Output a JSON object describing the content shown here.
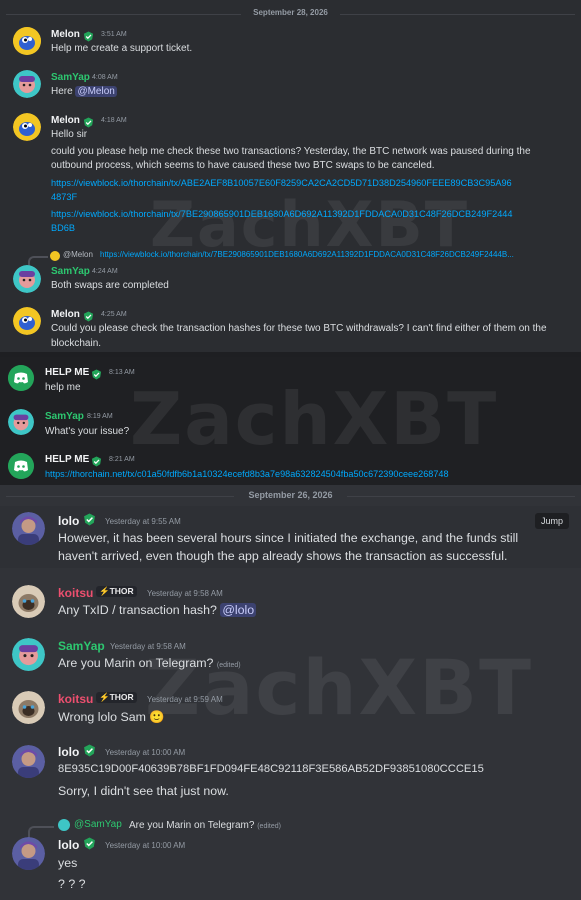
{
  "watermark": "ZachXBT",
  "colors": {
    "green_name": "#2dc770",
    "red_name": "#ed4f6f",
    "link": "#00a8fc",
    "mention_bg": "#3c4270"
  },
  "panel1": {
    "date": "September 28, 2026",
    "m1": {
      "author": "Melon",
      "time": "3:51 AM",
      "text": "Help me create a support ticket."
    },
    "m2": {
      "author": "SamYap",
      "time": "4:08 AM",
      "text_prefix": "Here ",
      "mention": "@Melon"
    },
    "m3": {
      "author": "Melon",
      "time": "4:18 AM",
      "line1": "Hello sir",
      "line2": "could you please help me check these two transactions? Yesterday, the BTC network was paused during the",
      "line3": "outbound process, which seems to have caused these two BTC swaps to be canceled.",
      "link1a": "https://viewblock.io/thorchain/tx/ABE2AEF8B10057E60F8259CA2CA2CD5D71D38D254960FEEE89CB3C95A96",
      "link1b": "4873F",
      "link2a": "https://viewblock.io/thorchain/tx/7BE290865901DEB1680A6D692A11392D1FDDACA0D31C48F26DCB249F2444",
      "link2b": "BD6B"
    },
    "m4": {
      "reply_author": "@Melon",
      "reply_text": "https://viewblock.io/thorchain/tx/7BE290865901DEB1680A6D692A11392D1FDDACA0D31C48F26DCB249F2444B...",
      "author": "SamYap",
      "time": "4:24 AM",
      "text": "Both swaps are completed"
    },
    "m5": {
      "author": "Melon",
      "time": "4:25 AM",
      "line1": "Could you please check the transaction hashes for these two BTC withdrawals? I can't find either of them on the",
      "line2": "blockchain."
    }
  },
  "panel2": {
    "m1": {
      "author": "HELP ME",
      "time": "8:13 AM",
      "text": "help me"
    },
    "m2": {
      "author": "SamYap",
      "time": "8:19 AM",
      "text": "What's your issue?"
    },
    "m3": {
      "author": "HELP ME",
      "time": "8:21 AM",
      "link": "https://thorchain.net/tx/c01a50fdfb6b1a10324ecefd8b3a7e98a632824504fba50c672390ceee268748"
    }
  },
  "panel3": {
    "date": "September 26, 2026",
    "jump": "Jump",
    "m1": {
      "author": "lolo",
      "time": "Yesterday at 9:55 AM",
      "line1": "However, it has been several hours since I initiated the exchange, and the funds still",
      "line2": "haven't arrived, even though the app already shows the transaction as successful."
    },
    "m2": {
      "author": "koitsu",
      "tag": "THOR",
      "time": "Yesterday at 9:58 AM",
      "text": "Any TxID / transaction hash?",
      "mention": "@lolo"
    },
    "m3": {
      "author": "SamYap",
      "time": "Yesterday at 9:58 AM",
      "text": "Are you Marin on Telegram?",
      "edited": "(edited)"
    },
    "m4": {
      "author": "koitsu",
      "tag": "THOR",
      "time": "Yesterday at 9:59 AM",
      "text": "Wrong lolo Sam",
      "emoji": "🙂"
    },
    "m5": {
      "author": "lolo",
      "time": "Yesterday at 10:00 AM",
      "line1": "8E935C19D00F40639B78BF1FD094FE48C92118F3E586AB52DF93851080CCCE15",
      "line2": "Sorry, I didn't see that just now."
    },
    "m6": {
      "reply_author": "@SamYap",
      "reply_text": "Are you Marin on Telegram?",
      "reply_edited": "(edited)",
      "author": "lolo",
      "time": "Yesterday at 10:00 AM",
      "line1": "yes",
      "line2": "? ? ?"
    }
  }
}
